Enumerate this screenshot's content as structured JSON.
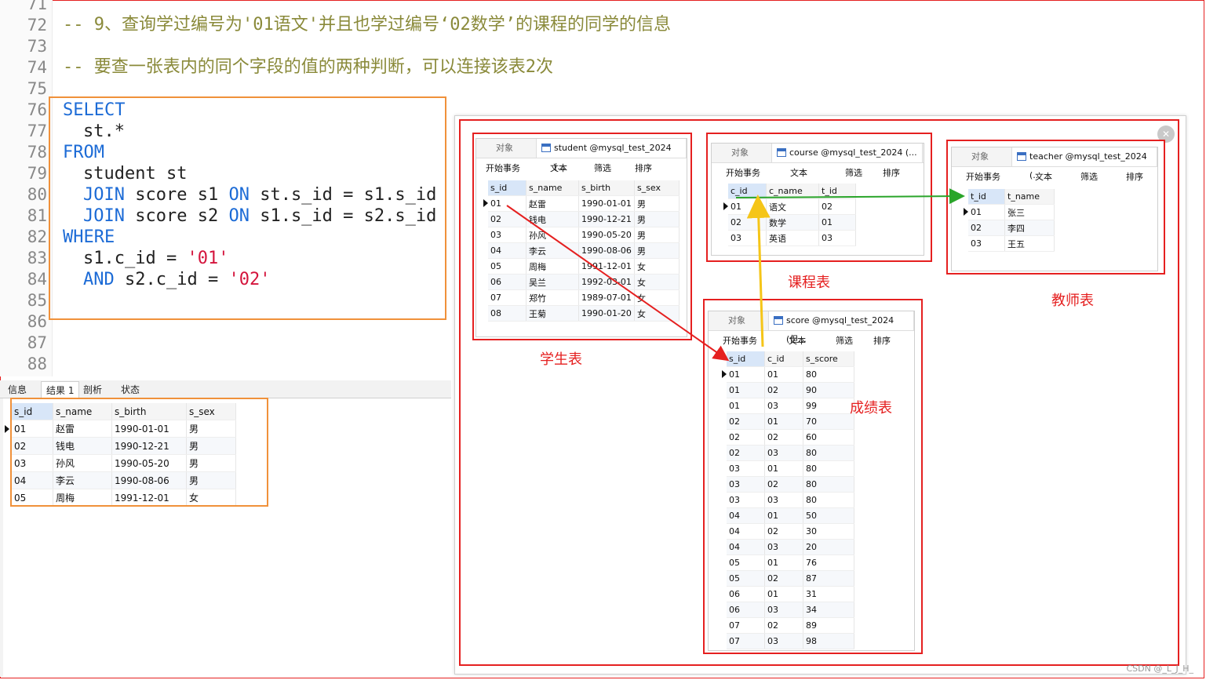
{
  "editor": {
    "line_numbers": [
      "71",
      "72",
      "73",
      "74",
      "75",
      "76",
      "77",
      "78",
      "79",
      "80",
      "81",
      "82",
      "83",
      "84",
      "85",
      "86",
      "87",
      "88"
    ],
    "comment1": "-- 9、查询学过编号为'01语文'并且也学过编号‘02数学’的课程的同学的信息",
    "comment2": "-- 要查一张表内的同个字段的值的两种判断，可以连接该表2次",
    "sql": {
      "select": "SELECT",
      "cols": "st.*",
      "from": "FROM",
      "from_table": "student st",
      "join": "JOIN",
      "on": "ON",
      "join1_table": "score s1",
      "join1_cond": "st.s_id = s1.s_id",
      "join2_table": "score s2",
      "join2_cond": "s1.s_id = s2.s_id",
      "where": "WHERE",
      "cond1_left": "s1.c_id =",
      "cond1_val": "'01'",
      "and": "AND",
      "cond2_left": "s2.c_id =",
      "cond2_val": "'02'"
    }
  },
  "result_tabs": [
    "信息",
    "结果 1",
    "剖析",
    "状态"
  ],
  "result_table": {
    "columns": [
      "s_id",
      "s_name",
      "s_birth",
      "s_sex"
    ],
    "rows": [
      [
        "01",
        "赵雷",
        "1990-01-01",
        "男"
      ],
      [
        "02",
        "钱电",
        "1990-12-21",
        "男"
      ],
      [
        "03",
        "孙风",
        "1990-05-20",
        "男"
      ],
      [
        "04",
        "李云",
        "1990-08-06",
        "男"
      ],
      [
        "05",
        "周梅",
        "1991-12-01",
        "女"
      ]
    ]
  },
  "panel_toolbar": {
    "object_tab": "对象",
    "begin_tx": "开始事务",
    "text": "文本",
    "filter": "筛选",
    "sort": "排序"
  },
  "student_window": {
    "tab_title": "student @mysql_test_2024 (...",
    "caption": "学生表",
    "columns": [
      "s_id",
      "s_name",
      "s_birth",
      "s_sex"
    ],
    "rows": [
      [
        "01",
        "赵雷",
        "1990-01-01",
        "男"
      ],
      [
        "02",
        "钱电",
        "1990-12-21",
        "男"
      ],
      [
        "03",
        "孙风",
        "1990-05-20",
        "男"
      ],
      [
        "04",
        "李云",
        "1990-08-06",
        "男"
      ],
      [
        "05",
        "周梅",
        "1991-12-01",
        "女"
      ],
      [
        "06",
        "吴兰",
        "1992-03-01",
        "女"
      ],
      [
        "07",
        "郑竹",
        "1989-07-01",
        "女"
      ],
      [
        "08",
        "王菊",
        "1990-01-20",
        "女"
      ]
    ]
  },
  "course_window": {
    "tab_title": "course @mysql_test_2024 (...",
    "caption": "课程表",
    "columns": [
      "c_id",
      "c_name",
      "t_id"
    ],
    "rows": [
      [
        "01",
        "语文",
        "02"
      ],
      [
        "02",
        "数学",
        "01"
      ],
      [
        "03",
        "英语",
        "03"
      ]
    ]
  },
  "teacher_window": {
    "tab_title": "teacher @mysql_test_2024 (...",
    "caption": "教师表",
    "columns": [
      "t_id",
      "t_name"
    ],
    "rows": [
      [
        "01",
        "张三"
      ],
      [
        "02",
        "李四"
      ],
      [
        "03",
        "王五"
      ]
    ]
  },
  "score_window": {
    "tab_title": "score @mysql_test_2024 (但...",
    "caption": "成绩表",
    "columns": [
      "s_id",
      "c_id",
      "s_score"
    ],
    "rows": [
      [
        "01",
        "01",
        "80"
      ],
      [
        "01",
        "02",
        "90"
      ],
      [
        "01",
        "03",
        "99"
      ],
      [
        "02",
        "01",
        "70"
      ],
      [
        "02",
        "02",
        "60"
      ],
      [
        "02",
        "03",
        "80"
      ],
      [
        "03",
        "01",
        "80"
      ],
      [
        "03",
        "02",
        "80"
      ],
      [
        "03",
        "03",
        "80"
      ],
      [
        "04",
        "01",
        "50"
      ],
      [
        "04",
        "02",
        "30"
      ],
      [
        "04",
        "03",
        "20"
      ],
      [
        "05",
        "01",
        "76"
      ],
      [
        "05",
        "02",
        "87"
      ],
      [
        "06",
        "01",
        "31"
      ],
      [
        "06",
        "03",
        "34"
      ],
      [
        "07",
        "02",
        "89"
      ],
      [
        "07",
        "03",
        "98"
      ]
    ]
  },
  "watermark": "CSDN @_L_J_H_",
  "colors": {
    "red_box": "#e52020",
    "orange_box": "#f0913a",
    "keyword": "#1c6bd6",
    "string": "#d4143c",
    "green_arrow": "#2aa52a",
    "yellow_arrow": "#f5c518"
  }
}
